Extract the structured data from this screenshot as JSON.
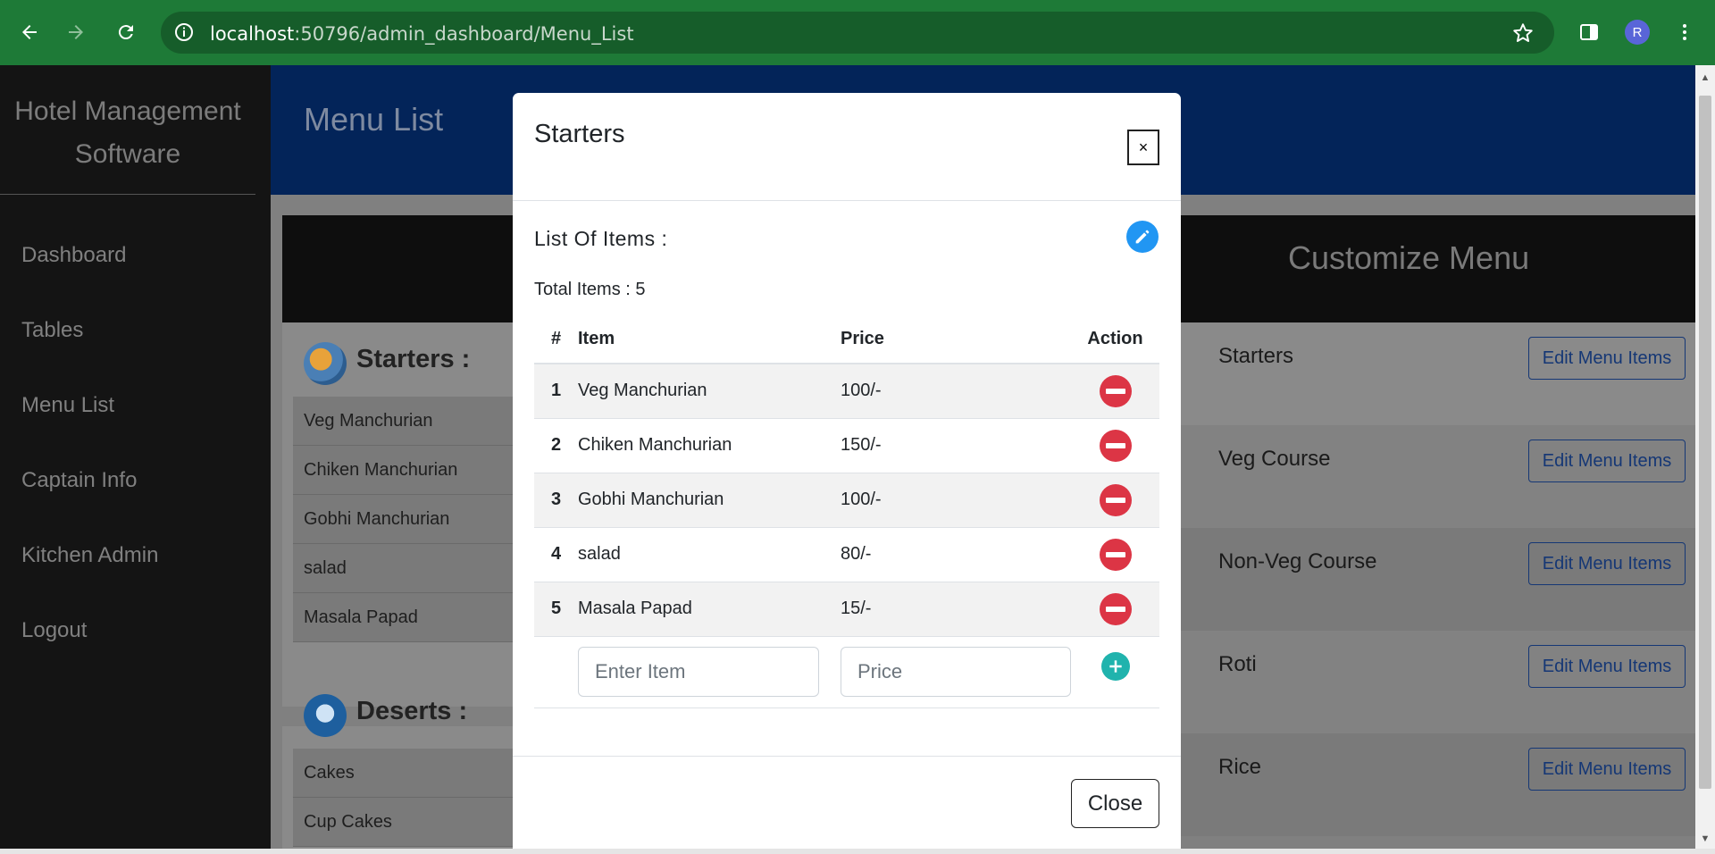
{
  "browser": {
    "url_host": "localhost",
    "url_rest": ":50796/admin_dashboard/Menu_List",
    "avatar_letter": "R"
  },
  "sidebar": {
    "brand_line1": "Hotel Management",
    "brand_line2": "Software",
    "items": [
      {
        "label": "Dashboard"
      },
      {
        "label": "Tables"
      },
      {
        "label": "Menu List"
      },
      {
        "label": "Captain Info"
      },
      {
        "label": "Kitchen Admin"
      },
      {
        "label": "Logout"
      }
    ]
  },
  "page": {
    "title": "Menu List",
    "customize_title": "Customize Menu"
  },
  "categories": [
    {
      "name": "Starters :",
      "items": [
        "Veg Manchurian",
        "Chiken Manchurian",
        "Gobhi Manchurian",
        "salad",
        "Masala Papad"
      ]
    },
    {
      "name": "Deserts :",
      "items": [
        "Cakes",
        "Cup Cakes"
      ]
    }
  ],
  "customize_rows": [
    {
      "label": "Starters",
      "button": "Edit Menu Items"
    },
    {
      "label": "Veg Course",
      "button": "Edit Menu Items"
    },
    {
      "label": "Non-Veg Course",
      "button": "Edit Menu Items"
    },
    {
      "label": "Roti",
      "button": "Edit Menu Items"
    },
    {
      "label": "Rice",
      "button": "Edit Menu Items"
    }
  ],
  "modal": {
    "title": "Starters",
    "close_x": "×",
    "list_label": "List Of Items :",
    "total_label": "Total Items : 5",
    "columns": [
      "#",
      "Item",
      "Price",
      "Action"
    ],
    "rows": [
      {
        "num": "1",
        "item": "Veg Manchurian",
        "price": "100/-"
      },
      {
        "num": "2",
        "item": "Chiken Manchurian",
        "price": "150/-"
      },
      {
        "num": "3",
        "item": "Gobhi Manchurian",
        "price": "100/-"
      },
      {
        "num": "4",
        "item": "salad",
        "price": "80/-"
      },
      {
        "num": "5",
        "item": "Masala Papad",
        "price": "15/-"
      }
    ],
    "item_placeholder": "Enter Item",
    "price_placeholder": "Price",
    "close_button": "Close"
  },
  "colors": {
    "chrome": "#1e7a37",
    "header_band": "#032459",
    "remove": "#dc3545",
    "add": "#20b3ad",
    "edit_fab": "#2196f3"
  }
}
